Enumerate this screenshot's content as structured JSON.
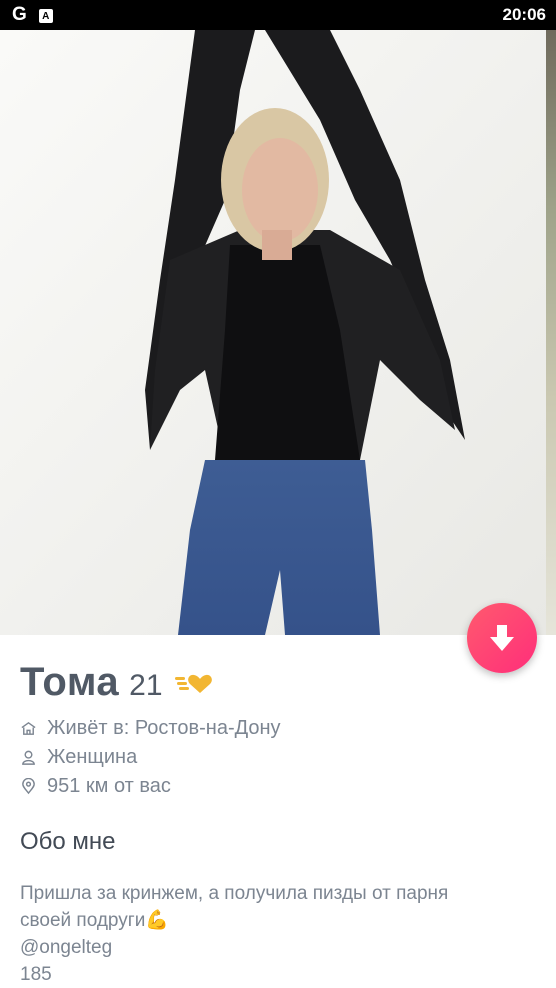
{
  "status_bar": {
    "icon_left_1": "google-icon",
    "icon_left_2": "accessibility-icon",
    "g_letter": "G",
    "a_letter": "A",
    "time": "20:06"
  },
  "photo": {
    "icon": "profile-photo"
  },
  "actions": {
    "collapse_icon": "arrow-down-icon",
    "accent": "#ff3f74"
  },
  "profile": {
    "name": "Тома",
    "age": "21",
    "lives_in": "Живёт в: Ростов-на-Дону",
    "gender": "Женщина",
    "distance": "951 км от вас"
  },
  "about": {
    "title": "Обо мне",
    "bio_line1": "Пришла за кринжем, а получила пизды от парня",
    "bio_line2": "своей подруги",
    "bio_emoji": "💪",
    "handle": "@ongelteg",
    "height": "185"
  }
}
